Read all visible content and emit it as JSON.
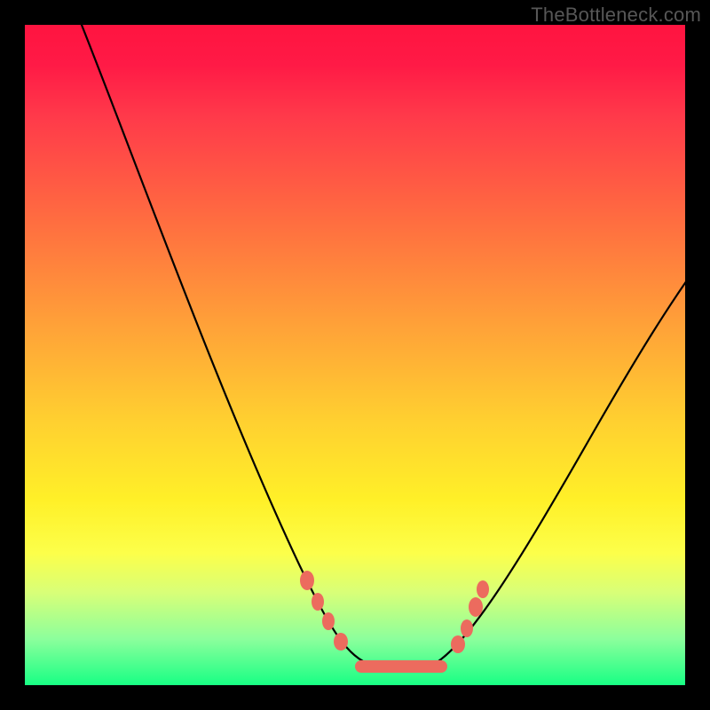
{
  "watermark": "TheBottleneck.com",
  "colors": {
    "marker": "#ec6b5e",
    "curve": "#000000",
    "frame": "#000000"
  },
  "chart_data": {
    "type": "line",
    "title": "",
    "xlabel": "",
    "ylabel": "",
    "xlim": [
      0,
      100
    ],
    "ylim": [
      0,
      100
    ],
    "x": [
      0,
      5,
      10,
      15,
      20,
      25,
      30,
      35,
      40,
      45,
      48,
      50,
      52,
      55,
      58,
      60,
      62,
      65,
      70,
      75,
      80,
      85,
      90,
      95,
      100
    ],
    "y": [
      100,
      90,
      80,
      70,
      60,
      50,
      40,
      30,
      20,
      10,
      5,
      2,
      1,
      1,
      1,
      1,
      2,
      6,
      15,
      24,
      32,
      40,
      47,
      54,
      60
    ],
    "series": [
      {
        "name": "bottleneck-curve",
        "x_ref": "x",
        "y_ref": "y"
      }
    ],
    "markers": {
      "note": "highlighted points along curve near valley",
      "points": [
        {
          "x": 42,
          "y": 12
        },
        {
          "x": 44,
          "y": 9
        },
        {
          "x": 46,
          "y": 6
        },
        {
          "x": 48,
          "y": 4
        },
        {
          "x": 52,
          "y": 1
        },
        {
          "x": 58,
          "y": 1
        },
        {
          "x": 63,
          "y": 3
        },
        {
          "x": 65,
          "y": 7
        },
        {
          "x": 67,
          "y": 11
        },
        {
          "x": 68,
          "y": 14
        }
      ],
      "valley_band": {
        "x_start": 50,
        "x_end": 62,
        "y": 1
      }
    }
  }
}
